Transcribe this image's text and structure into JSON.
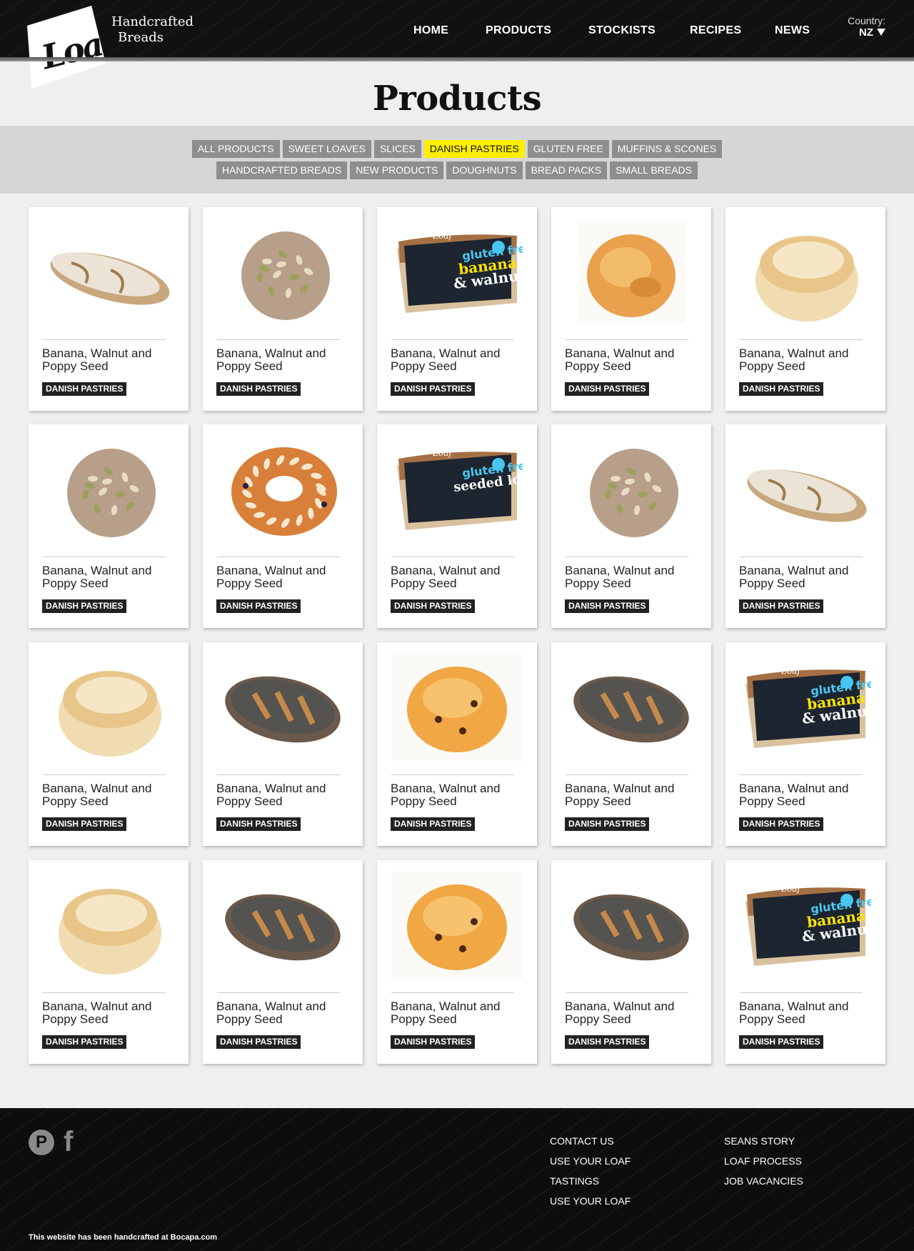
{
  "brand": {
    "logo_text": "Loaf",
    "tagline_line1": "Handcrafted",
    "tagline_line2": "Breads"
  },
  "nav": {
    "items": [
      "HOME",
      "PRODUCTS",
      "STOCKISTS",
      "RECIPES",
      "NEWS"
    ],
    "country_label": "Country:",
    "country_value": "NZ"
  },
  "page": {
    "title": "Products"
  },
  "filters": {
    "row1": [
      "ALL PRODUCTS",
      "SWEET LOAVES",
      "SLICES",
      "DANISH PASTRIES",
      "GLUTEN FREE",
      "MUFFINS & SCONES"
    ],
    "row2": [
      "HANDCRAFTED BREADS",
      "NEW PRODUCTS",
      "DOUGHNUTS",
      "BREAD PACKS",
      "SMALL BREADS"
    ],
    "active": "DANISH PASTRIES",
    "active_color": "#ffee00"
  },
  "products": [
    {
      "name": "Banana, Walnut and Poppy Seed",
      "tag": "DANISH PASTRIES",
      "image": "white-loaf"
    },
    {
      "name": "Banana, Walnut and Poppy Seed",
      "tag": "DANISH PASTRIES",
      "image": "seeded-roll"
    },
    {
      "name": "Banana, Walnut and Poppy Seed",
      "tag": "DANISH PASTRIES",
      "image": "gluten-free-pack"
    },
    {
      "name": "Banana, Walnut and Poppy Seed",
      "tag": "DANISH PASTRIES",
      "image": "muffin"
    },
    {
      "name": "Banana, Walnut and Poppy Seed",
      "tag": "DANISH PASTRIES",
      "image": "scone"
    },
    {
      "name": "Banana, Walnut and Poppy Seed",
      "tag": "DANISH PASTRIES",
      "image": "seeded-roll"
    },
    {
      "name": "Banana, Walnut and Poppy Seed",
      "tag": "DANISH PASTRIES",
      "image": "almond-ring"
    },
    {
      "name": "Banana, Walnut and Poppy Seed",
      "tag": "DANISH PASTRIES",
      "image": "gluten-free-pack-dark"
    },
    {
      "name": "Banana, Walnut and Poppy Seed",
      "tag": "DANISH PASTRIES",
      "image": "seeded-roll"
    },
    {
      "name": "Banana, Walnut and Poppy Seed",
      "tag": "DANISH PASTRIES",
      "image": "white-loaf"
    },
    {
      "name": "Banana, Walnut and Poppy Seed",
      "tag": "DANISH PASTRIES",
      "image": "scone"
    },
    {
      "name": "Banana, Walnut and Poppy Seed",
      "tag": "DANISH PASTRIES",
      "image": "poppy-loaf"
    },
    {
      "name": "Banana, Walnut and Poppy Seed",
      "tag": "DANISH PASTRIES",
      "image": "fruit-scone"
    },
    {
      "name": "Banana, Walnut and Poppy Seed",
      "tag": "DANISH PASTRIES",
      "image": "poppy-loaf"
    },
    {
      "name": "Banana, Walnut and Poppy Seed",
      "tag": "DANISH PASTRIES",
      "image": "gluten-free-pack"
    },
    {
      "name": "Banana, Walnut and Poppy Seed",
      "tag": "DANISH PASTRIES",
      "image": "scone"
    },
    {
      "name": "Banana, Walnut and Poppy Seed",
      "tag": "DANISH PASTRIES",
      "image": "poppy-loaf"
    },
    {
      "name": "Banana, Walnut and Poppy Seed",
      "tag": "DANISH PASTRIES",
      "image": "fruit-scone"
    },
    {
      "name": "Banana, Walnut and Poppy Seed",
      "tag": "DANISH PASTRIES",
      "image": "poppy-loaf"
    },
    {
      "name": "Banana, Walnut and Poppy Seed",
      "tag": "DANISH PASTRIES",
      "image": "gluten-free-pack"
    }
  ],
  "pack_labels": {
    "brand": "Loaf",
    "gluten_free": "gluten free",
    "banana": "banana",
    "walnut": "& walnut",
    "seeded": "seeded loaf"
  },
  "footer": {
    "social": [
      "pinterest-icon",
      "facebook-icon"
    ],
    "col1": [
      "CONTACT US",
      "USE YOUR LOAF",
      "TASTINGS",
      "USE YOUR LOAF"
    ],
    "col2": [
      "SEANS STORY",
      "LOAF PROCESS",
      "JOB VACANCIES"
    ],
    "credit": "This website has been handcrafted at Bocapa.com"
  }
}
